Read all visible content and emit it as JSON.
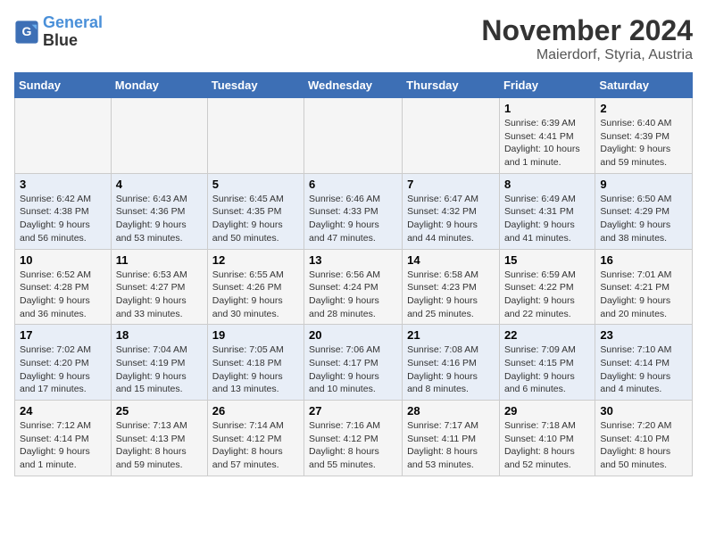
{
  "logo": {
    "line1": "General",
    "line2": "Blue"
  },
  "title": "November 2024",
  "location": "Maierdorf, Styria, Austria",
  "weekdays": [
    "Sunday",
    "Monday",
    "Tuesday",
    "Wednesday",
    "Thursday",
    "Friday",
    "Saturday"
  ],
  "weeks": [
    [
      {
        "day": "",
        "info": ""
      },
      {
        "day": "",
        "info": ""
      },
      {
        "day": "",
        "info": ""
      },
      {
        "day": "",
        "info": ""
      },
      {
        "day": "",
        "info": ""
      },
      {
        "day": "1",
        "info": "Sunrise: 6:39 AM\nSunset: 4:41 PM\nDaylight: 10 hours and 1 minute."
      },
      {
        "day": "2",
        "info": "Sunrise: 6:40 AM\nSunset: 4:39 PM\nDaylight: 9 hours and 59 minutes."
      }
    ],
    [
      {
        "day": "3",
        "info": "Sunrise: 6:42 AM\nSunset: 4:38 PM\nDaylight: 9 hours and 56 minutes."
      },
      {
        "day": "4",
        "info": "Sunrise: 6:43 AM\nSunset: 4:36 PM\nDaylight: 9 hours and 53 minutes."
      },
      {
        "day": "5",
        "info": "Sunrise: 6:45 AM\nSunset: 4:35 PM\nDaylight: 9 hours and 50 minutes."
      },
      {
        "day": "6",
        "info": "Sunrise: 6:46 AM\nSunset: 4:33 PM\nDaylight: 9 hours and 47 minutes."
      },
      {
        "day": "7",
        "info": "Sunrise: 6:47 AM\nSunset: 4:32 PM\nDaylight: 9 hours and 44 minutes."
      },
      {
        "day": "8",
        "info": "Sunrise: 6:49 AM\nSunset: 4:31 PM\nDaylight: 9 hours and 41 minutes."
      },
      {
        "day": "9",
        "info": "Sunrise: 6:50 AM\nSunset: 4:29 PM\nDaylight: 9 hours and 38 minutes."
      }
    ],
    [
      {
        "day": "10",
        "info": "Sunrise: 6:52 AM\nSunset: 4:28 PM\nDaylight: 9 hours and 36 minutes."
      },
      {
        "day": "11",
        "info": "Sunrise: 6:53 AM\nSunset: 4:27 PM\nDaylight: 9 hours and 33 minutes."
      },
      {
        "day": "12",
        "info": "Sunrise: 6:55 AM\nSunset: 4:26 PM\nDaylight: 9 hours and 30 minutes."
      },
      {
        "day": "13",
        "info": "Sunrise: 6:56 AM\nSunset: 4:24 PM\nDaylight: 9 hours and 28 minutes."
      },
      {
        "day": "14",
        "info": "Sunrise: 6:58 AM\nSunset: 4:23 PM\nDaylight: 9 hours and 25 minutes."
      },
      {
        "day": "15",
        "info": "Sunrise: 6:59 AM\nSunset: 4:22 PM\nDaylight: 9 hours and 22 minutes."
      },
      {
        "day": "16",
        "info": "Sunrise: 7:01 AM\nSunset: 4:21 PM\nDaylight: 9 hours and 20 minutes."
      }
    ],
    [
      {
        "day": "17",
        "info": "Sunrise: 7:02 AM\nSunset: 4:20 PM\nDaylight: 9 hours and 17 minutes."
      },
      {
        "day": "18",
        "info": "Sunrise: 7:04 AM\nSunset: 4:19 PM\nDaylight: 9 hours and 15 minutes."
      },
      {
        "day": "19",
        "info": "Sunrise: 7:05 AM\nSunset: 4:18 PM\nDaylight: 9 hours and 13 minutes."
      },
      {
        "day": "20",
        "info": "Sunrise: 7:06 AM\nSunset: 4:17 PM\nDaylight: 9 hours and 10 minutes."
      },
      {
        "day": "21",
        "info": "Sunrise: 7:08 AM\nSunset: 4:16 PM\nDaylight: 9 hours and 8 minutes."
      },
      {
        "day": "22",
        "info": "Sunrise: 7:09 AM\nSunset: 4:15 PM\nDaylight: 9 hours and 6 minutes."
      },
      {
        "day": "23",
        "info": "Sunrise: 7:10 AM\nSunset: 4:14 PM\nDaylight: 9 hours and 4 minutes."
      }
    ],
    [
      {
        "day": "24",
        "info": "Sunrise: 7:12 AM\nSunset: 4:14 PM\nDaylight: 9 hours and 1 minute."
      },
      {
        "day": "25",
        "info": "Sunrise: 7:13 AM\nSunset: 4:13 PM\nDaylight: 8 hours and 59 minutes."
      },
      {
        "day": "26",
        "info": "Sunrise: 7:14 AM\nSunset: 4:12 PM\nDaylight: 8 hours and 57 minutes."
      },
      {
        "day": "27",
        "info": "Sunrise: 7:16 AM\nSunset: 4:12 PM\nDaylight: 8 hours and 55 minutes."
      },
      {
        "day": "28",
        "info": "Sunrise: 7:17 AM\nSunset: 4:11 PM\nDaylight: 8 hours and 53 minutes."
      },
      {
        "day": "29",
        "info": "Sunrise: 7:18 AM\nSunset: 4:10 PM\nDaylight: 8 hours and 52 minutes."
      },
      {
        "day": "30",
        "info": "Sunrise: 7:20 AM\nSunset: 4:10 PM\nDaylight: 8 hours and 50 minutes."
      }
    ]
  ]
}
